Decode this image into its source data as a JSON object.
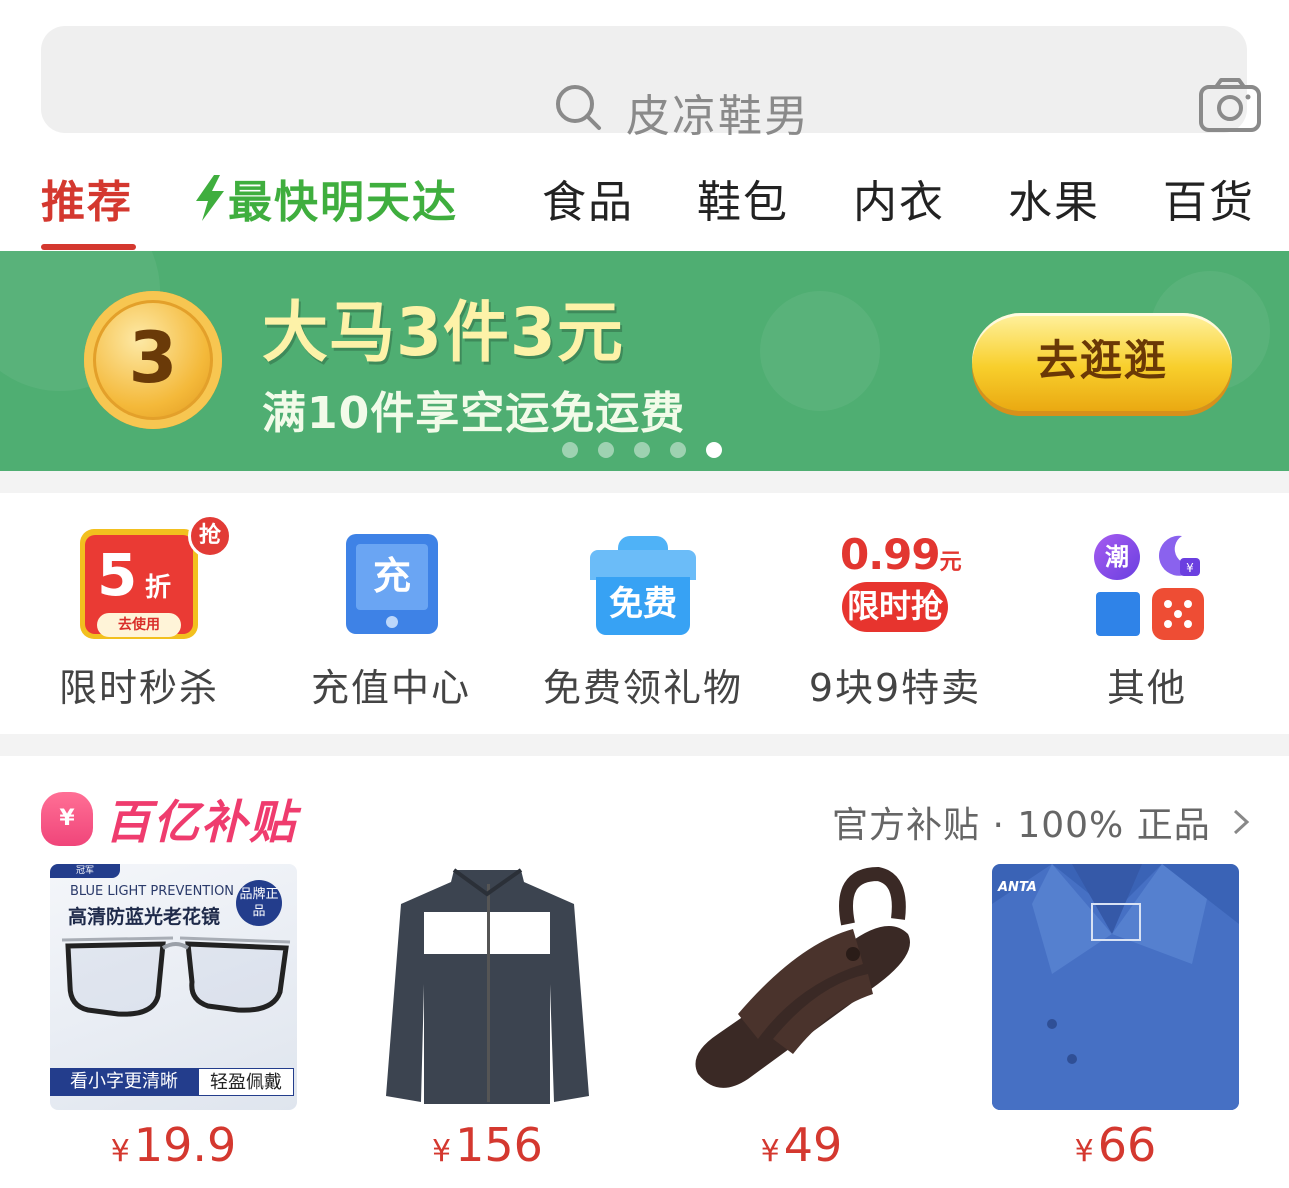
{
  "search": {
    "placeholder": "皮凉鞋男"
  },
  "tabs": [
    {
      "label": "推荐",
      "active": true
    },
    {
      "label": "最快明天达",
      "icon": "lightning-icon"
    },
    {
      "label": "食品"
    },
    {
      "label": "鞋包"
    },
    {
      "label": "内衣"
    },
    {
      "label": "水果"
    },
    {
      "label": "百货"
    }
  ],
  "banner": {
    "coin_number": "3",
    "title": "大马3件3元",
    "subtitle": "满10件享空运免运费",
    "button_label": "去逛逛",
    "dots_total": 5,
    "dots_active_index": 4,
    "background_color": "#4fae72"
  },
  "quick_entries": [
    {
      "label": "限时秒杀",
      "icon": "flash-sale-icon",
      "badge_discount": "5",
      "badge_unit": "折",
      "badge_action": "去使用",
      "badge_corner": "抢"
    },
    {
      "label": "充值中心",
      "icon": "recharge-icon",
      "icon_text": "充"
    },
    {
      "label": "免费领礼物",
      "icon": "gift-icon",
      "icon_text": "免费"
    },
    {
      "label": "9块9特卖",
      "icon": "special-sale-icon",
      "price": "0.99",
      "price_unit": "元",
      "pill_text": "限时抢"
    },
    {
      "label": "其他",
      "icon": "other-apps-icon",
      "mini_icon_text": "潮"
    }
  ],
  "subsidy": {
    "title": "百亿补贴",
    "right_text": "官方补贴 · 100% 正品"
  },
  "products": [
    {
      "name": "glasses",
      "currency": "¥",
      "price": "19.9",
      "img_text_en": "BLUE LIGHT PREVENTION",
      "img_text_cn": "高清防蓝光老花镜",
      "img_badge": "品牌正品",
      "img_footer_left": "看小字更清晰",
      "img_footer_right": "轻盈佩戴",
      "img_tag": "冠军"
    },
    {
      "name": "track-jacket",
      "currency": "¥",
      "price": "156"
    },
    {
      "name": "sandals",
      "currency": "¥",
      "price": "49"
    },
    {
      "name": "polo-shirt",
      "currency": "¥",
      "price": "66",
      "img_brand": "ANTA"
    }
  ],
  "colors": {
    "accent": "#d4382f",
    "fast_green": "#3fae3e",
    "subsidy_pink": "#ef3c6e"
  }
}
